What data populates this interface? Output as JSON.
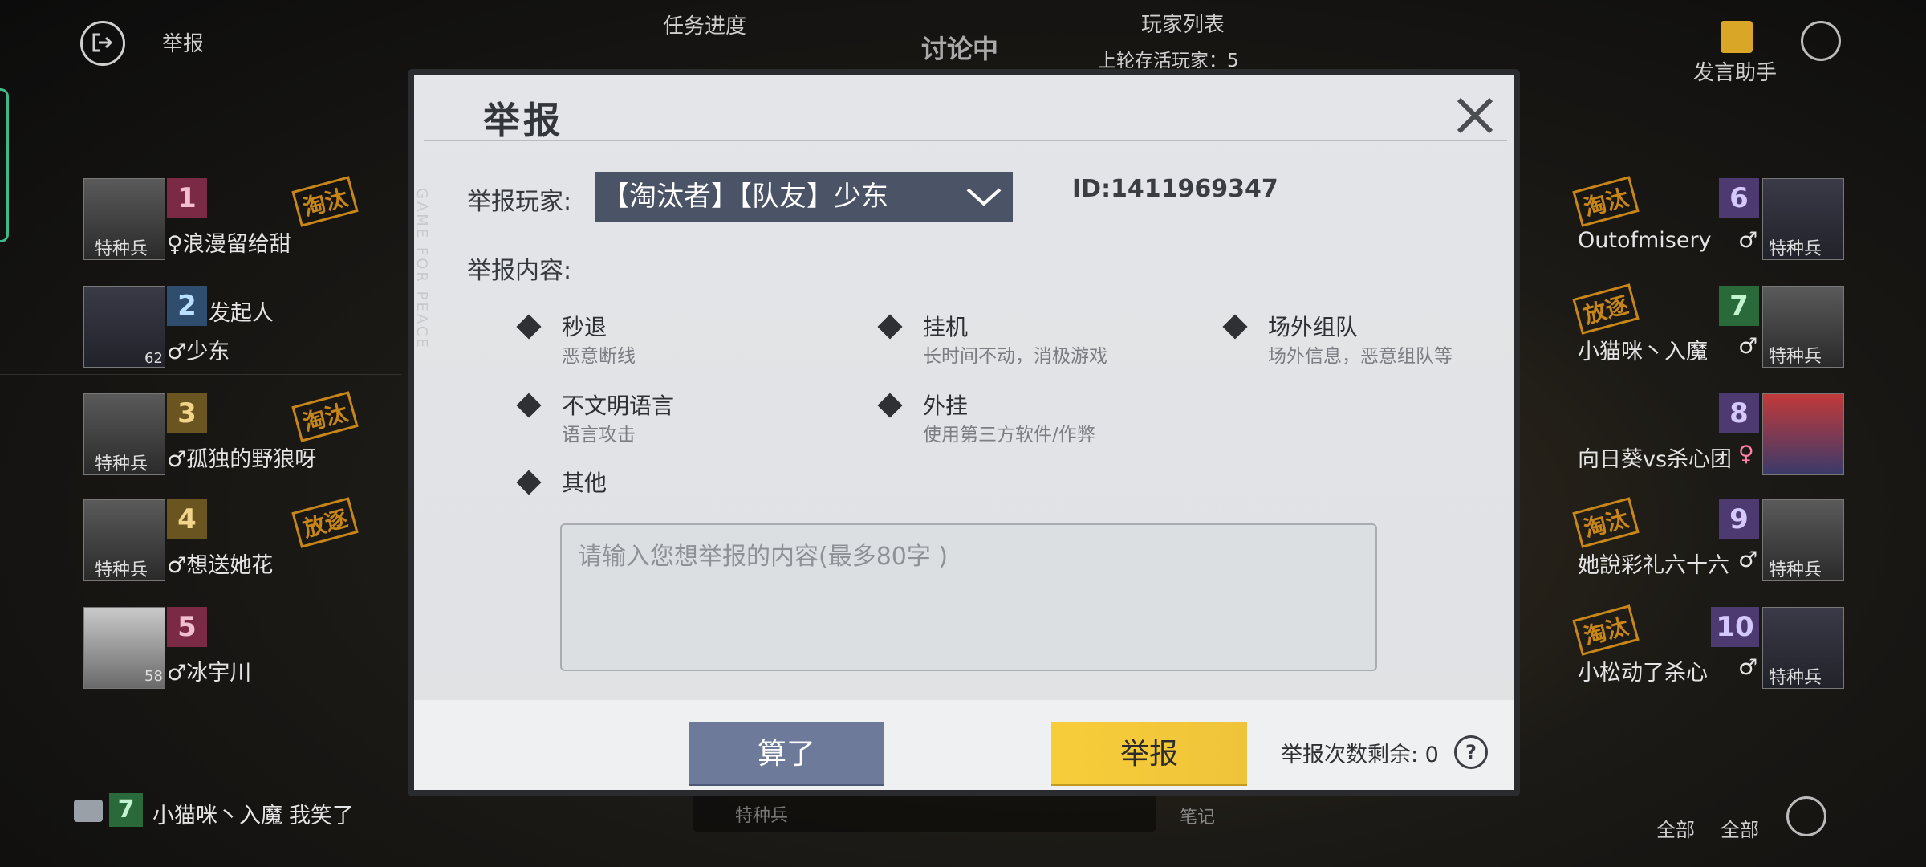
{
  "hud": {
    "report_label": "举报",
    "task_progress": "任务进度",
    "discussing": "讨论中",
    "player_list": "玩家列表",
    "last_round_alive": "上轮存活玩家：5",
    "speech_helper": "发言助手",
    "left_players": [
      {
        "seat": "1",
        "name": "♀浪漫留给甜",
        "role": "特种兵",
        "stamp": "淘汰"
      },
      {
        "seat": "2",
        "name": "♂少东",
        "role": "",
        "stamp": "",
        "badge": "发起人",
        "sub": "62"
      },
      {
        "seat": "3",
        "name": "♂孤独的野狼呀",
        "role": "特种兵",
        "stamp": "淘汰"
      },
      {
        "seat": "4",
        "name": "♂想送她花",
        "role": "特种兵",
        "stamp": "放逐"
      },
      {
        "seat": "5",
        "name": "♂冰宇川",
        "role": "",
        "stamp": "",
        "sub": "58"
      }
    ],
    "right_players": [
      {
        "seat": "6",
        "name": "Outofmisery",
        "gender": "♂",
        "role": "特种兵",
        "stamp": "淘汰"
      },
      {
        "seat": "7",
        "name": "小猫咪丶入魔",
        "gender": "♂",
        "role": "特种兵",
        "stamp": "放逐"
      },
      {
        "seat": "8",
        "name": "向日葵vs杀心团",
        "gender": "♀",
        "role": "",
        "stamp": ""
      },
      {
        "seat": "9",
        "name": "她說彩礼六十六",
        "gender": "♂",
        "role": "特种兵",
        "stamp": "淘汰"
      },
      {
        "seat": "10",
        "name": "小松动了杀心",
        "gender": "♂",
        "role": "特种兵",
        "stamp": "淘汰"
      }
    ],
    "chat": {
      "seat": "7",
      "name": "小猫咪丶入魔",
      "message": "我笑了"
    },
    "bottom_input_role": "特种兵",
    "notes_label": "笔记",
    "all_label": "全部",
    "all_label2": "全部"
  },
  "dialog": {
    "title": "举报",
    "report_player_label": "举报玩家:",
    "selected_player": "【淘汰者】【队友】少东",
    "player_id": "ID:1411969347",
    "report_content_label": "举报内容:",
    "options": [
      {
        "title": "秒退",
        "desc": "恶意断线"
      },
      {
        "title": "挂机",
        "desc": "长时间不动，消极游戏"
      },
      {
        "title": "场外组队",
        "desc": "场外信息，恶意组队等"
      },
      {
        "title": "不文明语言",
        "desc": "语言攻击"
      },
      {
        "title": "外挂",
        "desc": "使用第三方软件/作弊"
      },
      {
        "title": "其他",
        "desc": ""
      }
    ],
    "textarea_placeholder": "请输入您想举报的内容(最多80字 )",
    "cancel_label": "算了",
    "submit_label": "举报",
    "remaining_label": "举报次数剩余: 0",
    "watermark": "GAME FOR PEACE"
  },
  "colors": {
    "dialog_bg": "#e1e3e6",
    "select_bg": "#4b5467",
    "cancel_bg": "#6d7a9a",
    "submit_bg": "#f7cd3a"
  }
}
